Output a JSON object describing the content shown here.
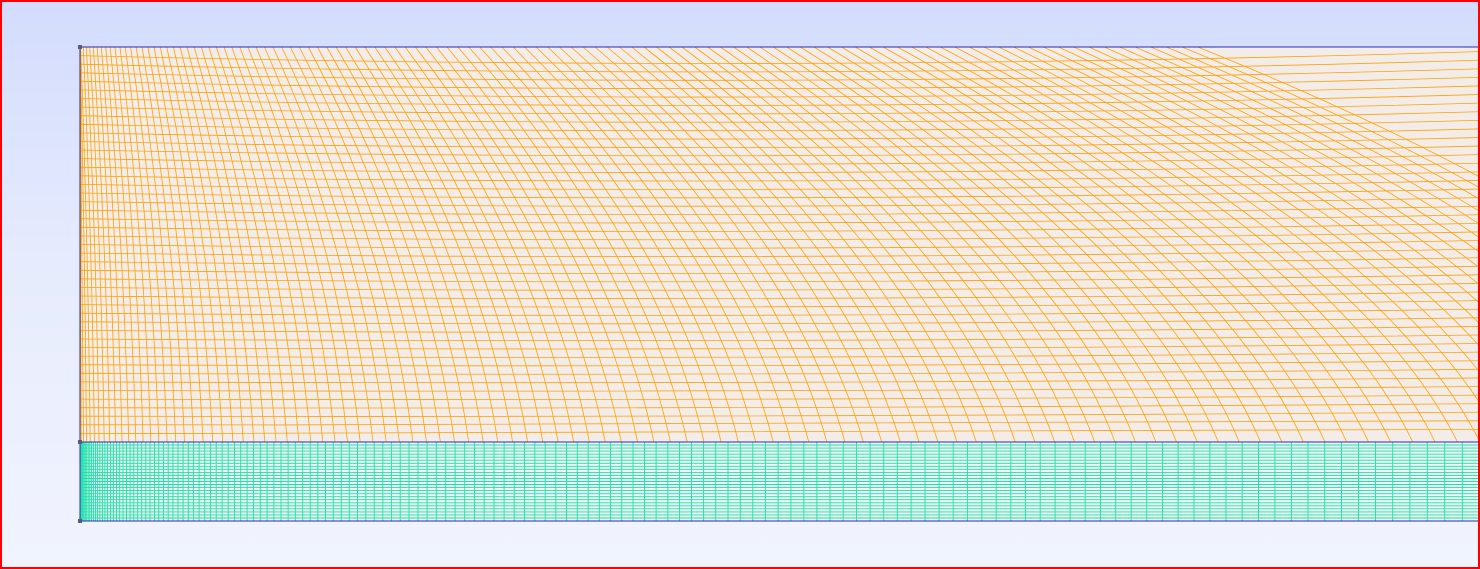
{
  "viewport": {
    "frame_color": "#ff0000",
    "background_top": "#d3dcfd",
    "background_bottom": "#f1f4fe"
  },
  "mesh": {
    "upper_region": {
      "fill": "#f3ece8",
      "edge_color": "#ffa200",
      "columns": 96,
      "rows": 46
    },
    "lower_region": {
      "fill": "#eef6f4",
      "edge_color": "#1fe0a8",
      "columns": 150,
      "rows": 26
    },
    "boundary_color": "#2a2ab8",
    "vertex_color": "#5a5a7a"
  }
}
